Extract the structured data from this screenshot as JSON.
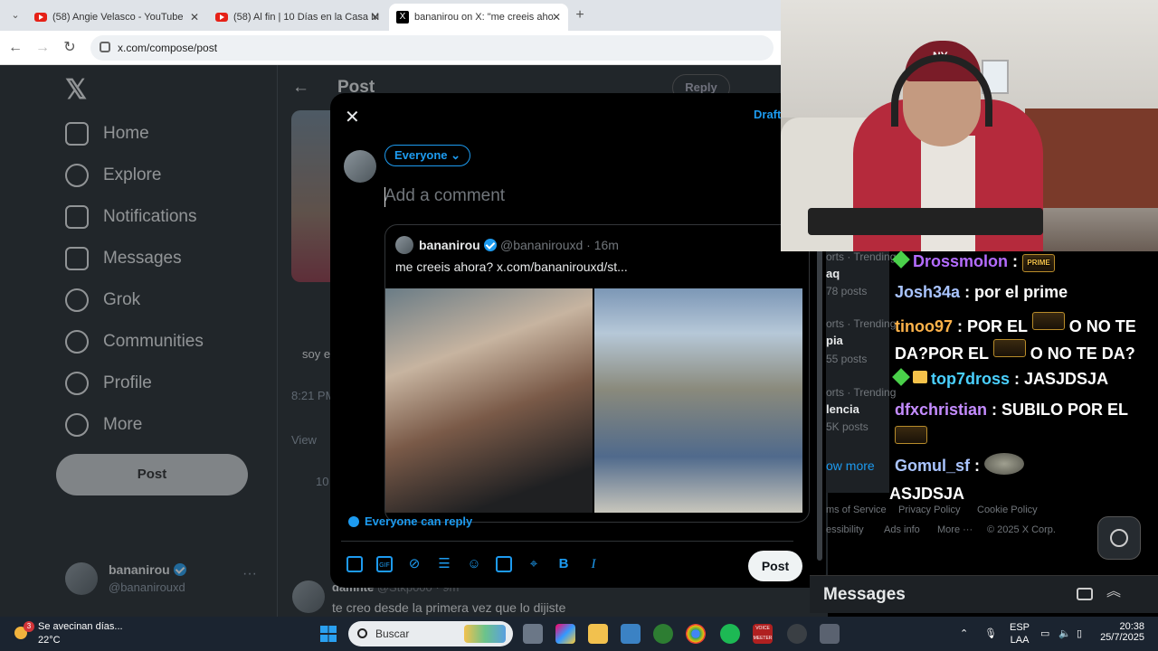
{
  "browser": {
    "tabs": [
      {
        "label": "(58) Angie Velasco - YouTube",
        "icon": "youtube-icon"
      },
      {
        "label": "(58) Al fin | 10 Días en la Casa M",
        "icon": "youtube-icon"
      },
      {
        "label": "bananirou on X: \"me creeis aho",
        "icon": "x-icon"
      }
    ],
    "url": "x.com/compose/post"
  },
  "sidenav": {
    "items": [
      "Home",
      "Explore",
      "Notifications",
      "Messages",
      "Grok",
      "Communities",
      "Profile",
      "More"
    ],
    "post_label": "Post",
    "account_name": "bananirou",
    "account_handle": "@bananirouxd"
  },
  "background": {
    "header_title": "Post",
    "reply_label": "Reply",
    "snippet_1": "soy e",
    "time": "8:21 PM",
    "views": "View",
    "count": "10",
    "reply_name": "damnte",
    "reply_handle": "@Stkp000 · 9m",
    "reply_text": "te creo desde la primera vez que lo dijiste"
  },
  "modal": {
    "drafts": "Drafts",
    "audience": "Everyone",
    "placeholder": "Add a comment",
    "quote": {
      "name": "bananirou",
      "meta": "@bananirouxd · 16m",
      "text": "me creeis ahora?  x.com/bananirouxd/st..."
    },
    "who_can_reply": "Everyone can reply",
    "post_label": "Post",
    "video_progress": 0.56
  },
  "trends": [
    {
      "cat": "orts · Trending",
      "name": "aq",
      "posts": "78 posts"
    },
    {
      "cat": "orts · Trending",
      "name": "pia",
      "posts": "55 posts"
    },
    {
      "cat": "orts · Trending",
      "name": "lencia",
      "posts": "5K posts"
    }
  ],
  "show_more": "ow more",
  "footer": [
    "ms of Service",
    "Privacy Policy",
    "Cookie Policy",
    "essibility",
    "Ads info",
    "More ···",
    "© 2025 X Corp."
  ],
  "messages_bar": "Messages",
  "chat": [
    {
      "user": "Drossmolon",
      "color": "#b46cff",
      "text": ":",
      "badge": "PRIME"
    },
    {
      "user": "Josh34a",
      "color": "#a9c4ff",
      "text": ": por el prime"
    },
    {
      "user": "tinoo97",
      "color": "#ffb34a",
      "text": ": POR EL",
      "text2": "O NO TE",
      "line2a": "DA?POR EL",
      "line2b": "O NO TE DA?"
    },
    {
      "user": "top7dross",
      "color": "#4ad0ff",
      "text": ": JASJDSJA"
    },
    {
      "user": "dfxchristian",
      "color": "#c48cff",
      "text": ": SUBILO POR EL"
    },
    {
      "user": "Gomul_sf",
      "color": "#a9c4ff",
      "text": ":"
    },
    {
      "user": "",
      "color": "#ffffff",
      "text": "ASJDSJA"
    }
  ],
  "webcam": {
    "cap_logo": "NY"
  },
  "taskbar": {
    "weather_title": "Se avecinan días...",
    "weather_temp": "22°C",
    "notif_count": "3",
    "search_label": "Buscar",
    "lang_1": "ESP",
    "lang_2": "LAA",
    "time": "20:38",
    "date": "25/7/2025",
    "voice_label": "VOICE MEETER"
  }
}
